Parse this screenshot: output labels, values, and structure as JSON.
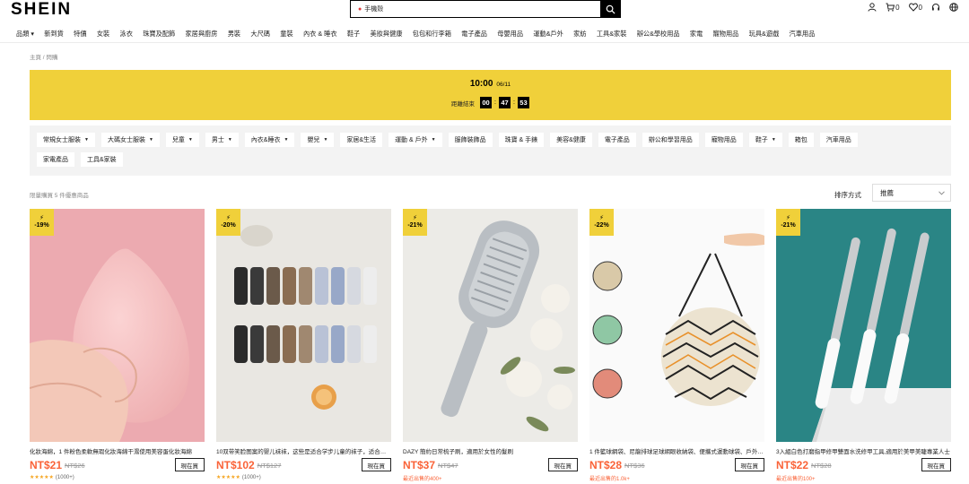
{
  "header": {
    "logo": "SHEIN",
    "search_value": "手機殼",
    "cart_count": "0",
    "wishlist_count": "0"
  },
  "nav": [
    "品類",
    "新到貨",
    "特價",
    "女裝",
    "泳衣",
    "珠寶及配飾",
    "家居與廚房",
    "男裝",
    "大尺碼",
    "童裝",
    "內衣 & 睡衣",
    "鞋子",
    "美妝與健康",
    "包包和行李箱",
    "電子產品",
    "母嬰用品",
    "運動&戶外",
    "家紡",
    "工具&家裝",
    "辦公&學校用品",
    "家電",
    "寵物用品",
    "玩具&遊戲",
    "汽車用品"
  ],
  "breadcrumb": "主頁 / 閃購",
  "banner": {
    "time": "10:00",
    "date": "06/11",
    "countdown_label": "距離結束",
    "hours": "00",
    "minutes": "47",
    "seconds": "53",
    "color": "#f0d03a"
  },
  "categories_row1": [
    {
      "label": "常規女士服裝",
      "dropdown": true
    },
    {
      "label": "大碼女士服裝",
      "dropdown": true
    },
    {
      "label": "兒童",
      "dropdown": true
    },
    {
      "label": "男士",
      "dropdown": true
    },
    {
      "label": "內衣&睡衣",
      "dropdown": true
    },
    {
      "label": "嬰兒",
      "dropdown": true
    },
    {
      "label": "家居&生活",
      "dropdown": false
    },
    {
      "label": "運動 & 戶外",
      "dropdown": true
    },
    {
      "label": "服飾裝飾品",
      "dropdown": false
    },
    {
      "label": "珠寶 & 手錶",
      "dropdown": false
    },
    {
      "label": "美容&健康",
      "dropdown": false
    },
    {
      "label": "電子產品",
      "dropdown": false
    },
    {
      "label": "辦公和學習用品",
      "dropdown": false
    },
    {
      "label": "寵物用品",
      "dropdown": false
    },
    {
      "label": "鞋子",
      "dropdown": true
    },
    {
      "label": "箱包",
      "dropdown": false
    },
    {
      "label": "汽車用品",
      "dropdown": false
    }
  ],
  "categories_row2": [
    {
      "label": "家電產品",
      "dropdown": false
    },
    {
      "label": "工具&家裝",
      "dropdown": false
    }
  ],
  "limit_text": "限量購買 5 件優惠商品",
  "sort": {
    "label": "排序方式",
    "value": "推薦"
  },
  "products": [
    {
      "discount": "-19%",
      "title": "化妝海綿，1 件粉色柔軟無瑕化妝海綿干濕使用美容蛋化妝海綿",
      "price": "NT$21",
      "old_price": "NT$26",
      "buy": "現在買",
      "stars": "★★★★★",
      "count": "(1000+)",
      "sold": ""
    },
    {
      "discount": "-20%",
      "title": "10双带笑脸图案的婴儿袜袜，这些是适合学步儿童的袜子，适合男孩和女孩",
      "price": "NT$102",
      "old_price": "NT$127",
      "buy": "現在買",
      "stars": "★★★★★",
      "count": "(1000+)",
      "sold": ""
    },
    {
      "discount": "-21%",
      "title": "DAZY 簡約日常梳子刷，適用於女性的髮刷",
      "price": "NT$37",
      "old_price": "NT$47",
      "buy": "現在買",
      "stars": "",
      "count": "",
      "sold": "最近出售的400+"
    },
    {
      "discount": "-22%",
      "title": "1 件籃球網袋、尼龍排球足球網眼收納袋、便攜式運動球袋、戶外運動",
      "price": "NT$28",
      "old_price": "NT$36",
      "buy": "現在買",
      "stars": "",
      "count": "",
      "sold": "最近出售的1.0k+"
    },
    {
      "discount": "-21%",
      "title": "3入組白色打磨指甲修甲雙面水洗修甲工具,適用於美甲美睫專業人士",
      "price": "NT$22",
      "old_price": "NT$28",
      "buy": "現在買",
      "stars": "",
      "count": "",
      "sold": "最近出售的100+"
    }
  ]
}
